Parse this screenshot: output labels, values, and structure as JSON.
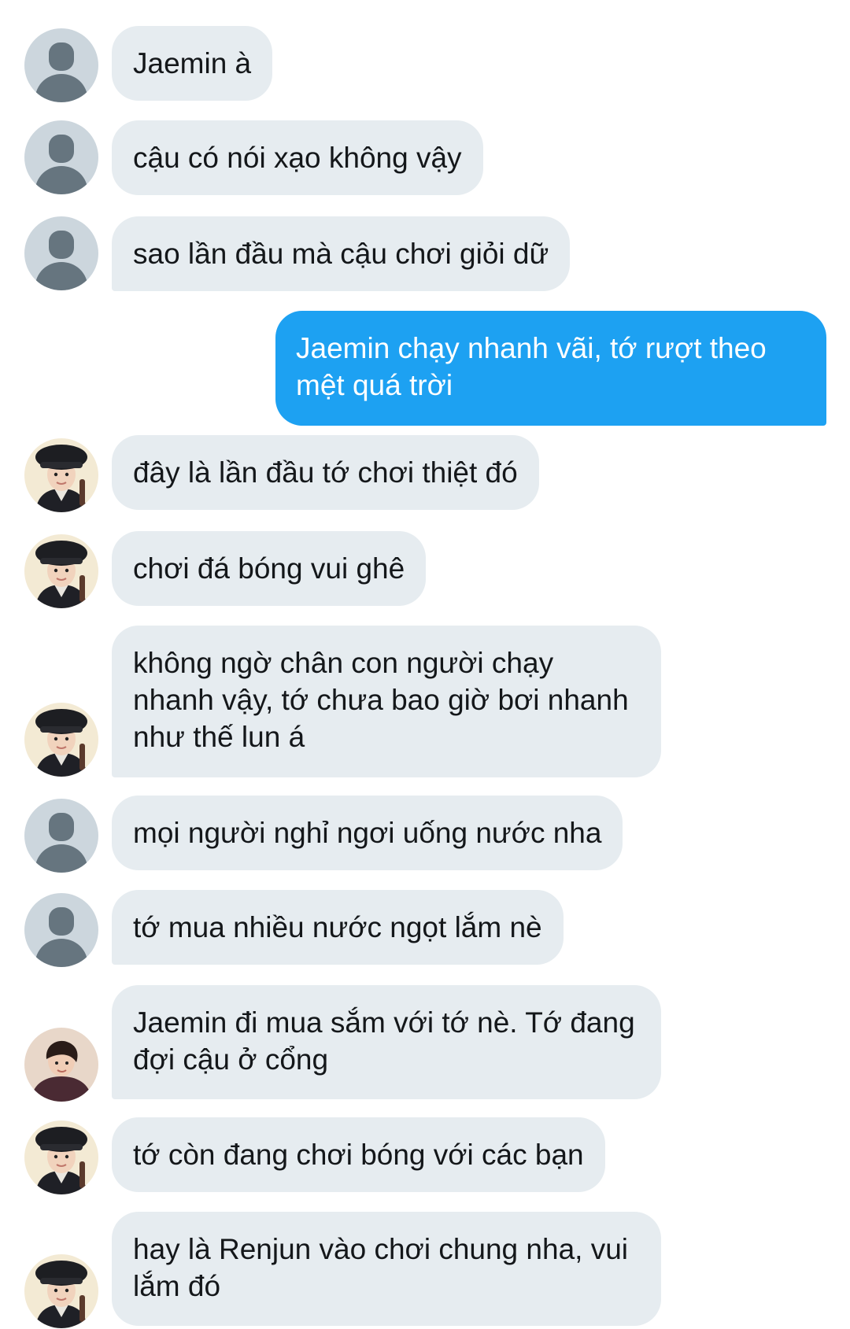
{
  "conversation": {
    "messages": [
      {
        "sender": "default",
        "direction": "in",
        "text": "Jaemin à"
      },
      {
        "sender": "default",
        "direction": "in",
        "text": "cậu có nói xạo không vậy"
      },
      {
        "sender": "default",
        "direction": "in",
        "text": "sao lần đầu mà cậu chơi giỏi dữ"
      },
      {
        "sender": "me",
        "direction": "out",
        "text": "Jaemin chạy nhanh vãi, tớ rượt theo mệt quá trời"
      },
      {
        "sender": "jaemin",
        "direction": "in",
        "text": "đây là lần đầu tớ chơi thiệt đó"
      },
      {
        "sender": "jaemin",
        "direction": "in",
        "text": "chơi đá bóng vui ghê"
      },
      {
        "sender": "jaemin",
        "direction": "in",
        "text": "không ngờ chân con người chạy nhanh vậy, tớ chưa bao giờ bơi nhanh như thế lun á"
      },
      {
        "sender": "default",
        "direction": "in",
        "text": "mọi người nghỉ ngơi uống nước nha"
      },
      {
        "sender": "default",
        "direction": "in",
        "text": "tớ mua nhiều nước ngọt lắm nè"
      },
      {
        "sender": "renjun",
        "direction": "in",
        "text": "Jaemin đi mua sắm với tớ nè. Tớ đang đợi cậu ở cổng"
      },
      {
        "sender": "jaemin",
        "direction": "in",
        "text": "tớ còn đang chơi bóng với các bạn"
      },
      {
        "sender": "jaemin",
        "direction": "in",
        "text": "hay là Renjun vào chơi chung nha, vui lắm đó"
      }
    ]
  },
  "colors": {
    "incoming_bubble": "#e6ecf0",
    "outgoing_bubble": "#1da1f2",
    "default_avatar_bg": "#ccd6dd",
    "default_avatar_fg": "#66757f"
  },
  "icons": {
    "default": "default-profile-icon",
    "jaemin": "boy-in-black-hat-photo",
    "renjun": "person-photo"
  }
}
